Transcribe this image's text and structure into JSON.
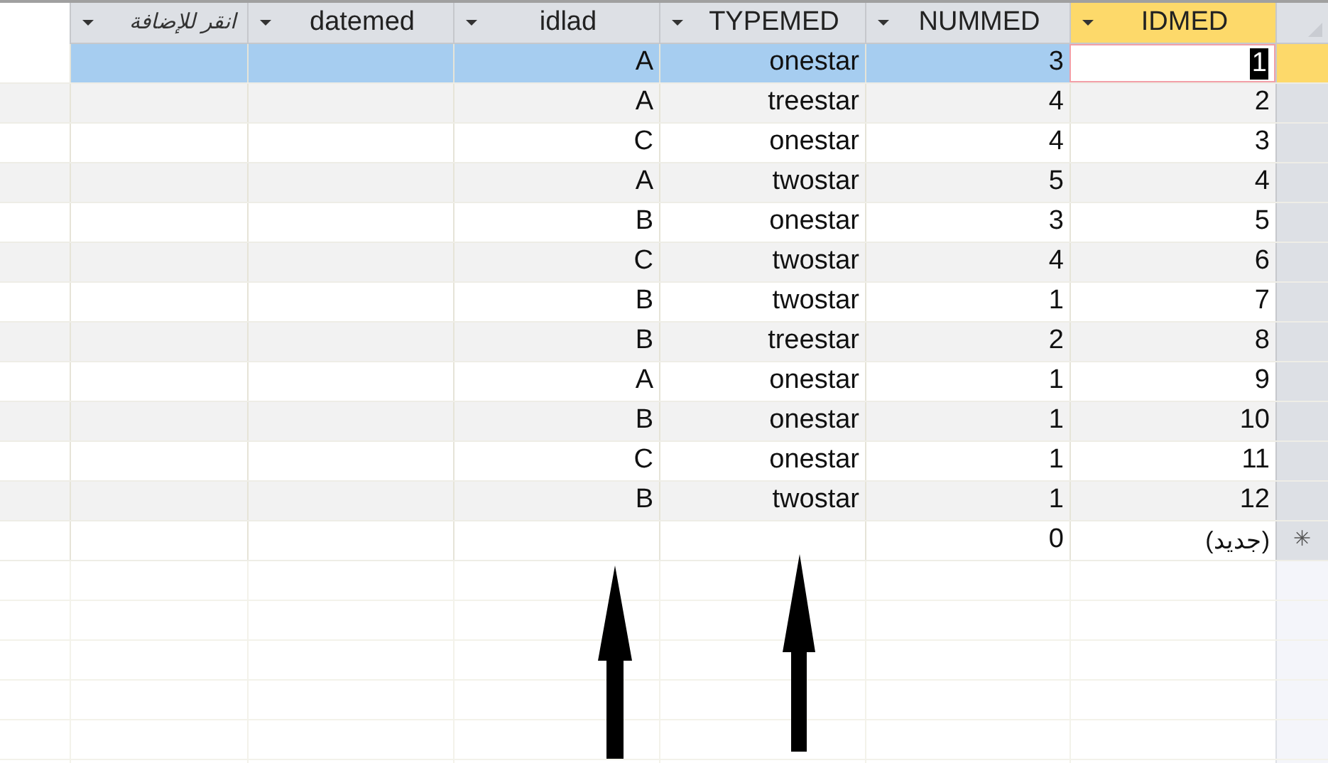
{
  "columns": [
    {
      "label": "انقر للإضافة",
      "selected": false,
      "kind": "add"
    },
    {
      "label": "datemed",
      "selected": false
    },
    {
      "label": "idlad",
      "selected": false
    },
    {
      "label": "TYPEMED",
      "selected": false
    },
    {
      "label": "NUMMED",
      "selected": false
    },
    {
      "label": "IDMED",
      "selected": true
    }
  ],
  "rows": [
    {
      "selected": true,
      "cells": [
        "",
        "",
        "A",
        "onestar",
        "3",
        "1"
      ]
    },
    {
      "selected": false,
      "cells": [
        "",
        "",
        "A",
        "treestar",
        "4",
        "2"
      ]
    },
    {
      "selected": false,
      "cells": [
        "",
        "",
        "C",
        "onestar",
        "4",
        "3"
      ]
    },
    {
      "selected": false,
      "cells": [
        "",
        "",
        "A",
        "twostar",
        "5",
        "4"
      ]
    },
    {
      "selected": false,
      "cells": [
        "",
        "",
        "B",
        "onestar",
        "3",
        "5"
      ]
    },
    {
      "selected": false,
      "cells": [
        "",
        "",
        "C",
        "twostar",
        "4",
        "6"
      ]
    },
    {
      "selected": false,
      "cells": [
        "",
        "",
        "B",
        "twostar",
        "1",
        "7"
      ]
    },
    {
      "selected": false,
      "cells": [
        "",
        "",
        "B",
        "treestar",
        "2",
        "8"
      ]
    },
    {
      "selected": false,
      "cells": [
        "",
        "",
        "A",
        "onestar",
        "1",
        "9"
      ]
    },
    {
      "selected": false,
      "cells": [
        "",
        "",
        "B",
        "onestar",
        "1",
        "10"
      ]
    },
    {
      "selected": false,
      "cells": [
        "",
        "",
        "C",
        "onestar",
        "1",
        "11"
      ]
    },
    {
      "selected": false,
      "cells": [
        "",
        "",
        "B",
        "twostar",
        "1",
        "12"
      ]
    }
  ],
  "new_row": {
    "cells": [
      "",
      "",
      "",
      "",
      "0",
      "(جديد)"
    ],
    "marker": "✳"
  }
}
